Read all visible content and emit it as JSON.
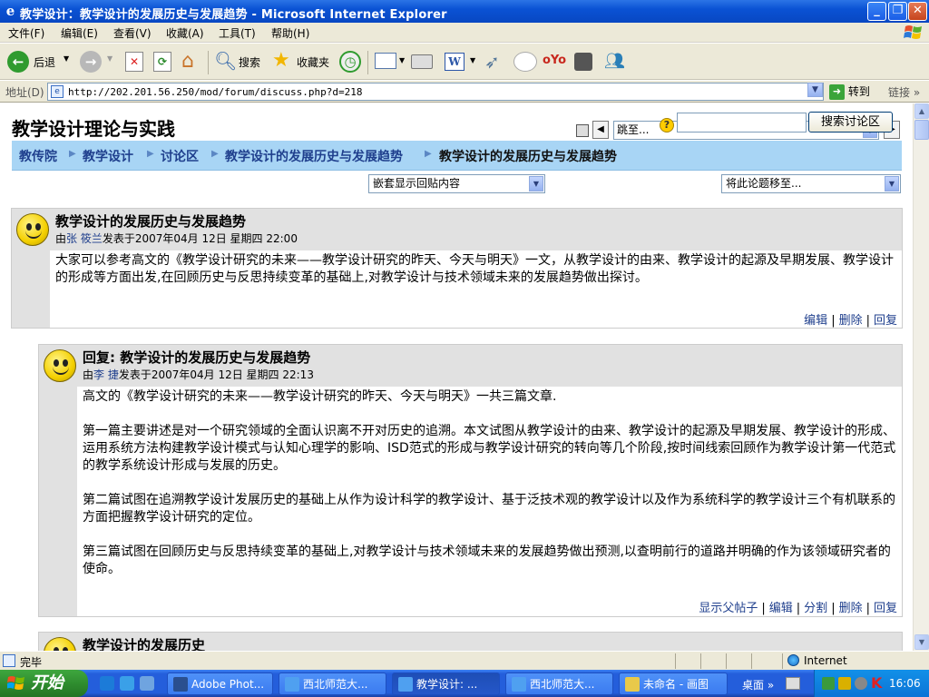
{
  "window": {
    "title": "教学设计：教学设计的发展历史与发展趋势 - Microsoft Internet Explorer"
  },
  "menu": [
    "文件(F)",
    "编辑(E)",
    "查看(V)",
    "收藏(A)",
    "工具(T)",
    "帮助(H)"
  ],
  "toolbar": {
    "back_label": "后退",
    "search_label": "搜索",
    "favorites_label": "收藏夹"
  },
  "address": {
    "label": "地址(D)",
    "url": "http://202.201.56.250/mod/forum/discuss.php?d=218",
    "go_label": "转到",
    "links_label": "链接"
  },
  "page": {
    "course_title": "教学设计理论与实践",
    "jump_placeholder": "跳至...",
    "breadcrumb": [
      "教传院",
      "教学设计",
      "讨论区",
      "教学设计的发展历史与发展趋势",
      "教学设计的发展历史与发展趋势"
    ],
    "search_button": "搜索讨论区",
    "display_mode": "嵌套显示回贴内容",
    "move_to": "将此论题移至..."
  },
  "posts": [
    {
      "subject": "教学设计的发展历史与发展趋势",
      "by": "由",
      "author": "张 筱兰",
      "posted": "发表于2007年04月 12日 星期四 22:00",
      "paragraphs": [
        "大家可以参考高文的《教学设计研究的未来——教学设计研究的昨天、今天与明天》一文，从教学设计的由来、教学设计的起源及早期发展、教学设计的形成等方面出发,在回顾历史与反思持续变革的基础上,对教学设计与技术领域未来的发展趋势做出探讨。"
      ],
      "commands": [
        "编辑",
        "删除",
        "回复"
      ]
    },
    {
      "subject": "回复: 教学设计的发展历史与发展趋势",
      "by": "由",
      "author": "李 捷",
      "posted": "发表于2007年04月 12日 星期四 22:13",
      "paragraphs": [
        "高文的《教学设计研究的未来——教学设计研究的昨天、今天与明天》一共三篇文章.",
        "第一篇主要讲述是对一个研究领域的全面认识离不开对历史的追溯。本文试图从教学设计的由来、教学设计的起源及早期发展、教学设计的形成、运用系统方法构建教学设计模式与认知心理学的影响、ISD范式的形成与教学设计研究的转向等几个阶段,按时间线索回顾作为教学设计第一代范式的教学系统设计形成与发展的历史。",
        "第二篇试图在追溯教学设计发展历史的基础上从作为设计科学的教学设计、基于泛技术观的教学设计以及作为系统科学的教学设计三个有机联系的方面把握教学设计研究的定位。",
        "第三篇试图在回顾历史与反思持续变革的基础上,对教学设计与技术领域未来的发展趋势做出预测,以查明前行的道路并明确的作为该领域研究者的使命。"
      ],
      "commands": [
        "显示父帖子",
        "编辑",
        "分割",
        "删除",
        "回复"
      ]
    },
    {
      "subject": "教学设计的发展历史"
    }
  ],
  "status": {
    "text": "完毕",
    "zone": "Internet"
  },
  "taskbar": {
    "start": "开始",
    "tasks": [
      "Adobe Phot...",
      "西北师范大...",
      "教学设计: ...",
      "西北师范大...",
      "未命名 - 画图"
    ],
    "desktop": "桌面",
    "clock": "16:06"
  },
  "colors": {
    "titlebar": "#0a52d4",
    "navbar": "#a8d5f5",
    "link": "#1f3f8d",
    "post_header": "#e1e1e1"
  }
}
